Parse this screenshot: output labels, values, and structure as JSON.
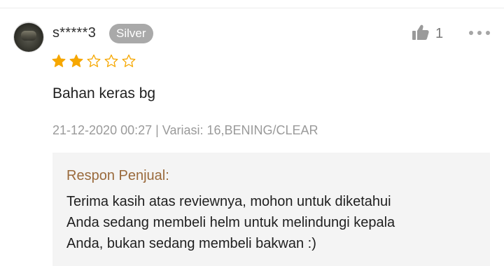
{
  "review": {
    "username": "s*****3",
    "badge": "Silver",
    "rating": 2,
    "max_rating": 5,
    "like_count": "1",
    "text": "Bahan keras bg",
    "meta": "21-12-2020 00:27 | Variasi: 16,BENING/CLEAR"
  },
  "seller_response": {
    "title": "Respon Penjual:",
    "body": "Terima kasih atas reviewnya, mohon untuk diketahui\nAnda sedang membeli helm untuk melindungi kepala\nAnda, bukan sedang membeli bakwan :)"
  },
  "icons": {
    "like": "thumbs-up-icon",
    "more": "more-dots-icon",
    "star_filled": "star-filled-icon",
    "star_empty": "star-outline-icon"
  },
  "colors": {
    "star": "#f6a700",
    "badge_bg": "#a9a9a9",
    "response_title": "#9a6a3c",
    "response_bg": "#f4f4f4"
  }
}
